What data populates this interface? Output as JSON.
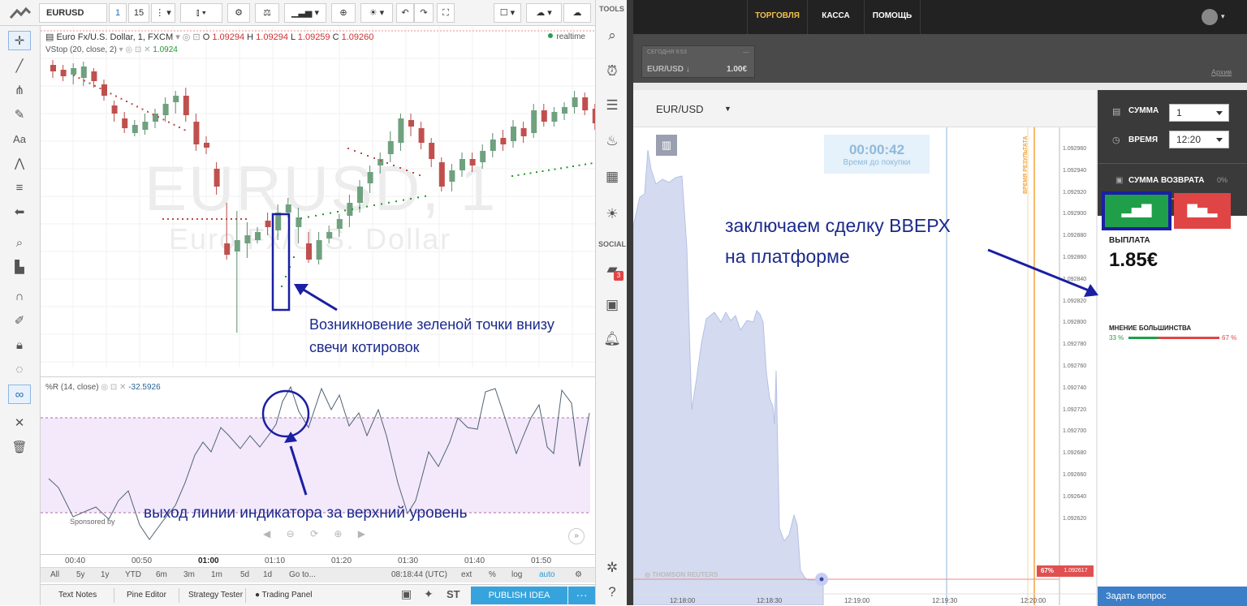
{
  "tv": {
    "symbol": "EURUSD",
    "interval": "1",
    "interval2": "15",
    "legend": {
      "title": "Euro Fx/U.S. Dollar, 1, FXCM",
      "o_label": "O",
      "o": "1.09294",
      "h_label": "H",
      "h": "1.09294",
      "l_label": "L",
      "l": "1.09259",
      "c_label": "C",
      "c": "1.09260"
    },
    "realtime": "realtime",
    "vstop": {
      "label": "VStop (20, close, 2)",
      "value": "1.0924"
    },
    "watermark": {
      "symbol": "EURUSD, 1",
      "name": "Euro Fx/U.S. Dollar"
    },
    "wr": {
      "label": "%R (14, close)",
      "value": "-32.5926"
    },
    "sponsored": "Sponsored by",
    "time_ticks": [
      "00:40",
      "00:50",
      "01:00",
      "01:10",
      "01:20",
      "01:30",
      "01:40",
      "01:50"
    ],
    "ranges": [
      "All",
      "5y",
      "1y",
      "YTD",
      "6m",
      "3m",
      "1m",
      "5d",
      "1d",
      "Go to..."
    ],
    "clock": "08:18:44 (UTC)",
    "scale_opts": [
      "ext",
      "%",
      "log",
      "auto"
    ],
    "tabs": [
      "Text Notes",
      "Pine Editor",
      "Strategy Tester",
      "Trading Panel"
    ],
    "publish": "PUBLISH IDEA",
    "tools_label": "TOOLS",
    "social_label": "SOCIAL",
    "social_badge": "3"
  },
  "annotations": {
    "green_dot_line1": "Возникновение зеленой точки внизу",
    "green_dot_line2": "свечи котировок",
    "indicator_exit": "выход линии индикатора за верхний уровень",
    "deal_up_line1": "заключаем сделку ВВЕРХ",
    "deal_up_line2": "на платформе"
  },
  "platform": {
    "nav": [
      "ТОРГОВЛЯ",
      "КАССА",
      "ПОМОЩЬ"
    ],
    "deal_card": {
      "time": "СЕГОДНЯ 9:53",
      "dash": "—",
      "pair": "EUR/USD ↓",
      "amount": "1.00€"
    },
    "archive": "Архив",
    "pair": "EUR/USD",
    "countdown": "00:00:42",
    "countdown_label": "Время до покупки",
    "result_label": "ВРЕМЯ РЕЗУЛЬТАТА",
    "price_axis": [
      "1.092960",
      "1.092940",
      "1.092920",
      "1.092900",
      "1.092880",
      "1.092860",
      "1.092840",
      "1.092820",
      "1.092800",
      "1.092780",
      "1.092760",
      "1.092740",
      "1.092720",
      "1.092700",
      "1.092680",
      "1.092660",
      "1.092640",
      "1.092620"
    ],
    "current_price": "1.092617",
    "current_pct": "67%",
    "time_axis": [
      "12:18:00",
      "12:18:30",
      "12:19:00",
      "12:19:30",
      "12:20:00"
    ],
    "reuters": "THOMSON REUTERS",
    "sum_label": "СУММА",
    "sum_value": "1",
    "time_label": "ВРЕМЯ",
    "time_value": "12:20",
    "return_label": "СУММА ВОЗВРАТА",
    "return_value": "0%",
    "payout_label": "ВЫПЛАТА",
    "payout_value": "1.85€",
    "majority_label": "МНЕНИЕ БОЛЬШИНСТВА",
    "majority_up": "33 %",
    "majority_up_fraction": 0.33,
    "majority_down": "67 %",
    "ask": "Задать вопрос"
  }
}
